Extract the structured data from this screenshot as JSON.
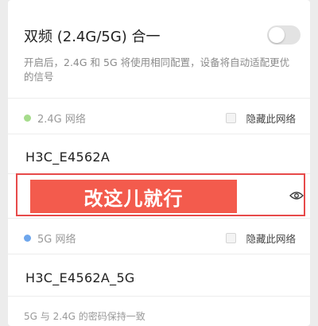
{
  "merge": {
    "label": "双频 (2.4G/5G) 合一",
    "enabled": false,
    "description": "开启后，2.4G 和 5G 将使用相同配置，设备将自动适配更优的信号"
  },
  "band_24": {
    "title": "2.4G 网络",
    "dot_color": "#a6dc8c",
    "hide_label": "隐藏此网络",
    "ssid": "H3C_E4562A",
    "password_banner": "改这儿就行"
  },
  "band_5": {
    "title": "5G 网络",
    "dot_color": "#6ea6ec",
    "hide_label": "隐藏此网络",
    "ssid": "H3C_E4562A_5G"
  },
  "note": "5G 与 2.4G 的密码保持一致",
  "icons": {
    "toggle": "toggle-off",
    "eye": "eye-icon",
    "checkbox": "checkbox-unchecked"
  },
  "colors": {
    "annotation_red": "#e74a4a",
    "banner_red": "#f35b4d"
  }
}
